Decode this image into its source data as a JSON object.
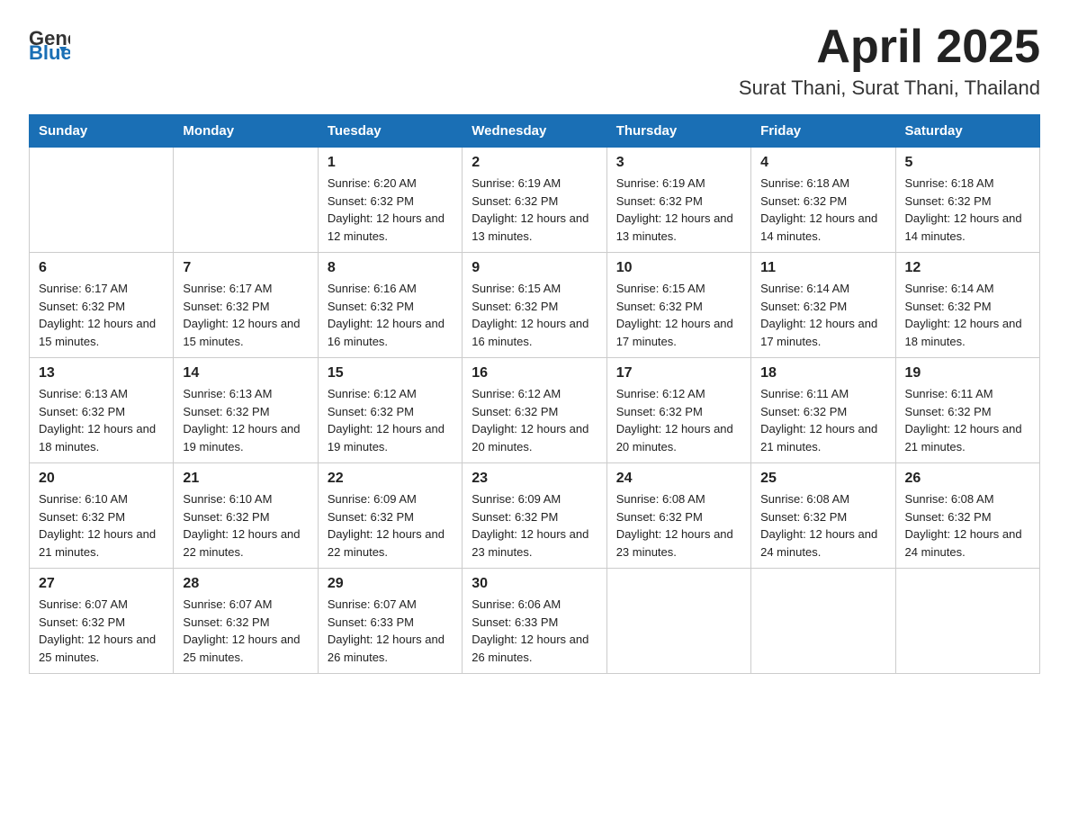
{
  "header": {
    "logo_general": "General",
    "logo_blue": "Blue",
    "month_title": "April 2025",
    "subtitle": "Surat Thani, Surat Thani, Thailand"
  },
  "weekdays": [
    "Sunday",
    "Monday",
    "Tuesday",
    "Wednesday",
    "Thursday",
    "Friday",
    "Saturday"
  ],
  "weeks": [
    [
      {
        "day": "",
        "sunrise": "",
        "sunset": "",
        "daylight": ""
      },
      {
        "day": "",
        "sunrise": "",
        "sunset": "",
        "daylight": ""
      },
      {
        "day": "1",
        "sunrise": "Sunrise: 6:20 AM",
        "sunset": "Sunset: 6:32 PM",
        "daylight": "Daylight: 12 hours and 12 minutes."
      },
      {
        "day": "2",
        "sunrise": "Sunrise: 6:19 AM",
        "sunset": "Sunset: 6:32 PM",
        "daylight": "Daylight: 12 hours and 13 minutes."
      },
      {
        "day": "3",
        "sunrise": "Sunrise: 6:19 AM",
        "sunset": "Sunset: 6:32 PM",
        "daylight": "Daylight: 12 hours and 13 minutes."
      },
      {
        "day": "4",
        "sunrise": "Sunrise: 6:18 AM",
        "sunset": "Sunset: 6:32 PM",
        "daylight": "Daylight: 12 hours and 14 minutes."
      },
      {
        "day": "5",
        "sunrise": "Sunrise: 6:18 AM",
        "sunset": "Sunset: 6:32 PM",
        "daylight": "Daylight: 12 hours and 14 minutes."
      }
    ],
    [
      {
        "day": "6",
        "sunrise": "Sunrise: 6:17 AM",
        "sunset": "Sunset: 6:32 PM",
        "daylight": "Daylight: 12 hours and 15 minutes."
      },
      {
        "day": "7",
        "sunrise": "Sunrise: 6:17 AM",
        "sunset": "Sunset: 6:32 PM",
        "daylight": "Daylight: 12 hours and 15 minutes."
      },
      {
        "day": "8",
        "sunrise": "Sunrise: 6:16 AM",
        "sunset": "Sunset: 6:32 PM",
        "daylight": "Daylight: 12 hours and 16 minutes."
      },
      {
        "day": "9",
        "sunrise": "Sunrise: 6:15 AM",
        "sunset": "Sunset: 6:32 PM",
        "daylight": "Daylight: 12 hours and 16 minutes."
      },
      {
        "day": "10",
        "sunrise": "Sunrise: 6:15 AM",
        "sunset": "Sunset: 6:32 PM",
        "daylight": "Daylight: 12 hours and 17 minutes."
      },
      {
        "day": "11",
        "sunrise": "Sunrise: 6:14 AM",
        "sunset": "Sunset: 6:32 PM",
        "daylight": "Daylight: 12 hours and 17 minutes."
      },
      {
        "day": "12",
        "sunrise": "Sunrise: 6:14 AM",
        "sunset": "Sunset: 6:32 PM",
        "daylight": "Daylight: 12 hours and 18 minutes."
      }
    ],
    [
      {
        "day": "13",
        "sunrise": "Sunrise: 6:13 AM",
        "sunset": "Sunset: 6:32 PM",
        "daylight": "Daylight: 12 hours and 18 minutes."
      },
      {
        "day": "14",
        "sunrise": "Sunrise: 6:13 AM",
        "sunset": "Sunset: 6:32 PM",
        "daylight": "Daylight: 12 hours and 19 minutes."
      },
      {
        "day": "15",
        "sunrise": "Sunrise: 6:12 AM",
        "sunset": "Sunset: 6:32 PM",
        "daylight": "Daylight: 12 hours and 19 minutes."
      },
      {
        "day": "16",
        "sunrise": "Sunrise: 6:12 AM",
        "sunset": "Sunset: 6:32 PM",
        "daylight": "Daylight: 12 hours and 20 minutes."
      },
      {
        "day": "17",
        "sunrise": "Sunrise: 6:12 AM",
        "sunset": "Sunset: 6:32 PM",
        "daylight": "Daylight: 12 hours and 20 minutes."
      },
      {
        "day": "18",
        "sunrise": "Sunrise: 6:11 AM",
        "sunset": "Sunset: 6:32 PM",
        "daylight": "Daylight: 12 hours and 21 minutes."
      },
      {
        "day": "19",
        "sunrise": "Sunrise: 6:11 AM",
        "sunset": "Sunset: 6:32 PM",
        "daylight": "Daylight: 12 hours and 21 minutes."
      }
    ],
    [
      {
        "day": "20",
        "sunrise": "Sunrise: 6:10 AM",
        "sunset": "Sunset: 6:32 PM",
        "daylight": "Daylight: 12 hours and 21 minutes."
      },
      {
        "day": "21",
        "sunrise": "Sunrise: 6:10 AM",
        "sunset": "Sunset: 6:32 PM",
        "daylight": "Daylight: 12 hours and 22 minutes."
      },
      {
        "day": "22",
        "sunrise": "Sunrise: 6:09 AM",
        "sunset": "Sunset: 6:32 PM",
        "daylight": "Daylight: 12 hours and 22 minutes."
      },
      {
        "day": "23",
        "sunrise": "Sunrise: 6:09 AM",
        "sunset": "Sunset: 6:32 PM",
        "daylight": "Daylight: 12 hours and 23 minutes."
      },
      {
        "day": "24",
        "sunrise": "Sunrise: 6:08 AM",
        "sunset": "Sunset: 6:32 PM",
        "daylight": "Daylight: 12 hours and 23 minutes."
      },
      {
        "day": "25",
        "sunrise": "Sunrise: 6:08 AM",
        "sunset": "Sunset: 6:32 PM",
        "daylight": "Daylight: 12 hours and 24 minutes."
      },
      {
        "day": "26",
        "sunrise": "Sunrise: 6:08 AM",
        "sunset": "Sunset: 6:32 PM",
        "daylight": "Daylight: 12 hours and 24 minutes."
      }
    ],
    [
      {
        "day": "27",
        "sunrise": "Sunrise: 6:07 AM",
        "sunset": "Sunset: 6:32 PM",
        "daylight": "Daylight: 12 hours and 25 minutes."
      },
      {
        "day": "28",
        "sunrise": "Sunrise: 6:07 AM",
        "sunset": "Sunset: 6:32 PM",
        "daylight": "Daylight: 12 hours and 25 minutes."
      },
      {
        "day": "29",
        "sunrise": "Sunrise: 6:07 AM",
        "sunset": "Sunset: 6:33 PM",
        "daylight": "Daylight: 12 hours and 26 minutes."
      },
      {
        "day": "30",
        "sunrise": "Sunrise: 6:06 AM",
        "sunset": "Sunset: 6:33 PM",
        "daylight": "Daylight: 12 hours and 26 minutes."
      },
      {
        "day": "",
        "sunrise": "",
        "sunset": "",
        "daylight": ""
      },
      {
        "day": "",
        "sunrise": "",
        "sunset": "",
        "daylight": ""
      },
      {
        "day": "",
        "sunrise": "",
        "sunset": "",
        "daylight": ""
      }
    ]
  ]
}
